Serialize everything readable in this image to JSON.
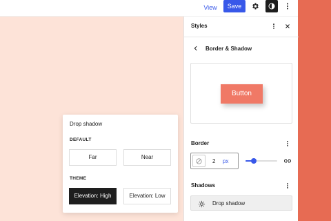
{
  "topbar": {
    "view_label": "View",
    "save_label": "Save",
    "icons": [
      "gear-icon",
      "contrast-icon",
      "more-vertical-icon"
    ]
  },
  "sidebar": {
    "title": "Styles",
    "nav_title": "Border & Shadow",
    "preview_button_label": "Button",
    "border": {
      "label": "Border",
      "width_value": "2",
      "unit": "px",
      "slider_fraction": 0.25
    },
    "shadows": {
      "label": "Shadows",
      "item_label": "Drop shadow"
    }
  },
  "popover": {
    "title": "Drop shadow",
    "default_section": "DEFAULT",
    "default_options": [
      "Far",
      "Near"
    ],
    "theme_section": "THEME",
    "theme_options": [
      "Elevation: High",
      "Elevation: Low"
    ],
    "selected": "Elevation: High"
  },
  "colors": {
    "accent": "#3858e9",
    "canvas_background": "#fde3d8",
    "side_background": "#e76b53",
    "preview_button": "#f07966"
  }
}
